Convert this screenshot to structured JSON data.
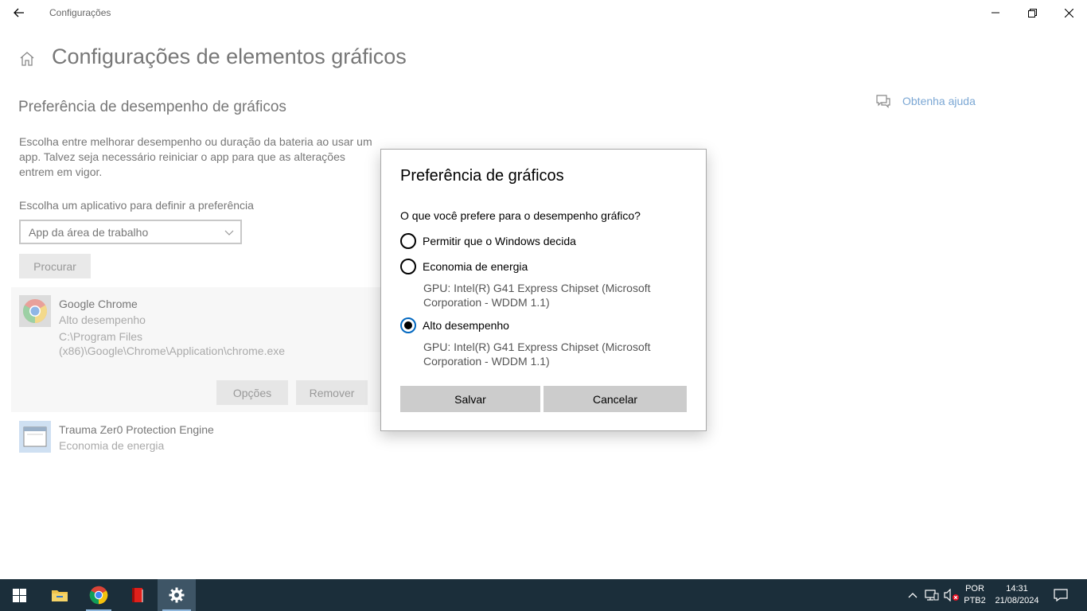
{
  "window": {
    "title": "Configurações"
  },
  "page": {
    "title": "Configurações de elementos gráficos",
    "section_title": "Preferência de desempenho de gráficos",
    "description": "Escolha entre melhorar desempenho ou duração da bateria ao usar um app. Talvez seja necessário reiniciar o app para que as alterações entrem em vigor.",
    "choose_label": "Escolha um aplicativo para definir a preferência",
    "select_value": "App da área de trabalho",
    "browse_label": "Procurar",
    "help_link": "Obtenha ajuda"
  },
  "apps": [
    {
      "name": "Google Chrome",
      "preference": "Alto desempenho",
      "path": "C:\\Program Files (x86)\\Google\\Chrome\\Application\\chrome.exe",
      "options_label": "Opções",
      "remove_label": "Remover"
    },
    {
      "name": "Trauma Zer0 Protection Engine",
      "preference": "Economia de energia"
    }
  ],
  "dialog": {
    "title": "Preferência de gráficos",
    "question": "O que você prefere para o desempenho gráfico?",
    "options": [
      {
        "label": "Permitir que o Windows decida",
        "selected": false
      },
      {
        "label": "Economia de energia",
        "gpu": "GPU: Intel(R) G41 Express Chipset (Microsoft Corporation - WDDM 1.1)",
        "selected": false
      },
      {
        "label": "Alto desempenho",
        "gpu": "GPU: Intel(R) G41 Express Chipset (Microsoft Corporation - WDDM 1.1)",
        "selected": true
      }
    ],
    "save_label": "Salvar",
    "cancel_label": "Cancelar"
  },
  "taskbar": {
    "language": "POR",
    "layout": "PTB2",
    "time": "14:31",
    "date": "21/08/2024"
  },
  "colors": {
    "accent": "#0067c0",
    "taskbar": "#1b2e3a",
    "link": "#7ba7d4"
  }
}
